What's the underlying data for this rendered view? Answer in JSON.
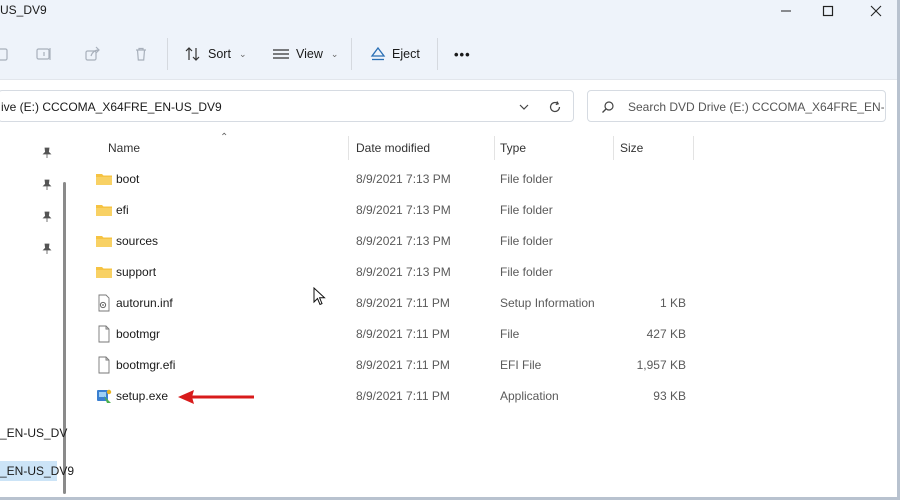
{
  "window": {
    "title": "US_DV9"
  },
  "commandbar": {
    "sort_label": "Sort",
    "view_label": "View",
    "eject_label": "Eject",
    "more_label": "•••"
  },
  "address": {
    "path": "ive (E:) CCCOMA_X64FRE_EN-US_DV9",
    "search_placeholder": "Search DVD Drive (E:) CCCOMA_X64FRE_EN-US..."
  },
  "nav": {
    "items": [
      {
        "label": "_EN-US_DV"
      },
      {
        "label": "_EN-US_DV9"
      }
    ]
  },
  "columns": {
    "name": "Name",
    "date": "Date modified",
    "type": "Type",
    "size": "Size"
  },
  "files": [
    {
      "name": "boot",
      "date": "8/9/2021 7:13 PM",
      "type": "File folder",
      "size": "",
      "icon": "folder-icon"
    },
    {
      "name": "efi",
      "date": "8/9/2021 7:13 PM",
      "type": "File folder",
      "size": "",
      "icon": "folder-icon"
    },
    {
      "name": "sources",
      "date": "8/9/2021 7:13 PM",
      "type": "File folder",
      "size": "",
      "icon": "folder-icon"
    },
    {
      "name": "support",
      "date": "8/9/2021 7:13 PM",
      "type": "File folder",
      "size": "",
      "icon": "folder-icon"
    },
    {
      "name": "autorun.inf",
      "date": "8/9/2021 7:11 PM",
      "type": "Setup Information",
      "size": "1 KB",
      "icon": "setup-info-file-icon"
    },
    {
      "name": "bootmgr",
      "date": "8/9/2021 7:11 PM",
      "type": "File",
      "size": "427 KB",
      "icon": "file-icon"
    },
    {
      "name": "bootmgr.efi",
      "date": "8/9/2021 7:11 PM",
      "type": "EFI File",
      "size": "1,957 KB",
      "icon": "file-icon"
    },
    {
      "name": "setup.exe",
      "date": "8/9/2021 7:11 PM",
      "type": "Application",
      "size": "93 KB",
      "icon": "setup-exe-icon"
    }
  ],
  "colors": {
    "chrome_bg": "#eef3fa",
    "folder_yellow": "#f6c342",
    "arrow_red": "#d81b1b",
    "nav_selected": "#cce4f7"
  }
}
